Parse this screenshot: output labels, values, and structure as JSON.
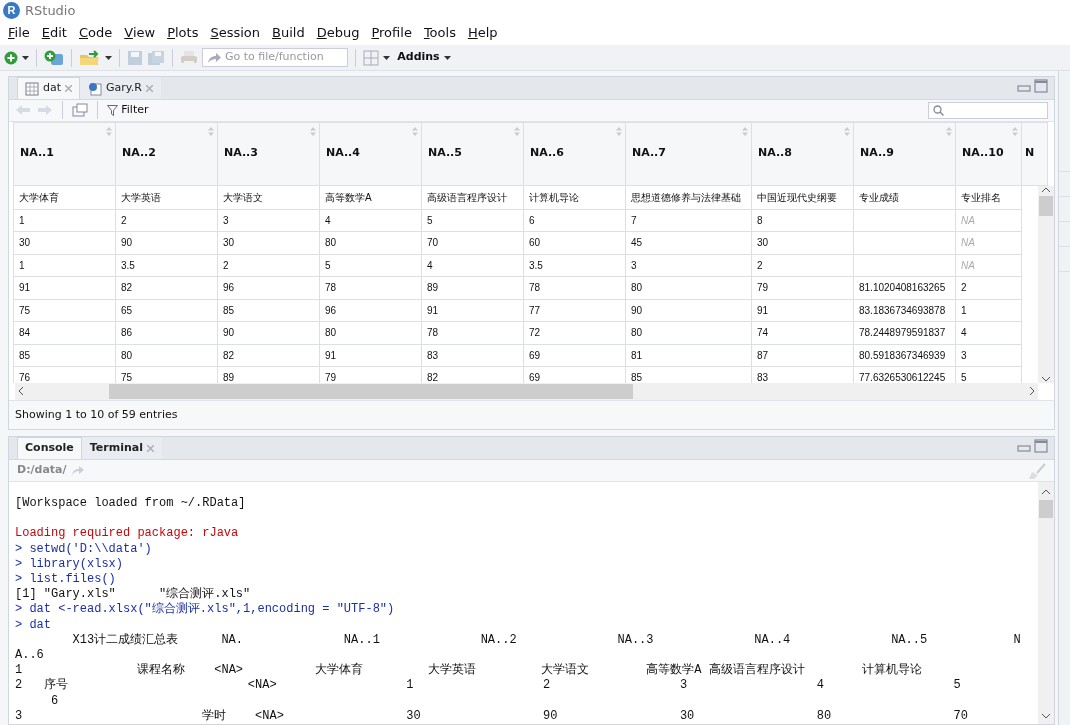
{
  "window": {
    "logo_text": "R",
    "title": "RStudio"
  },
  "menu": [
    "File",
    "Edit",
    "Code",
    "View",
    "Plots",
    "Session",
    "Build",
    "Debug",
    "Profile",
    "Tools",
    "Help"
  ],
  "toolbar": {
    "goto_placeholder": "Go to file/function",
    "addins": "Addins",
    "save_disabled": true,
    "print_disabled": true
  },
  "source_pane": {
    "tabs": [
      {
        "label": "dat",
        "kind": "data",
        "selected": true
      },
      {
        "label": "Gary.R",
        "kind": "script",
        "selected": false
      }
    ],
    "filter_label": "Filter",
    "history_disabled": true,
    "table": {
      "columns": [
        "NA..1",
        "NA..2",
        "NA..3",
        "NA..4",
        "NA..5",
        "NA..6",
        "NA..7",
        "NA..8",
        "NA..9",
        "NA..10",
        "N"
      ],
      "rows": [
        {
          "cells": [
            "大学体育",
            "大学英语",
            "大学语文",
            "高等数学A",
            "高级语言程序设计",
            "计算机导论",
            "思想道德修养与法律基础",
            "中国近现代史纲要",
            "专业成绩",
            "专业排名"
          ]
        },
        {
          "cells": [
            "1",
            "2",
            "3",
            "4",
            "5",
            "6",
            "7",
            "8",
            null,
            {
              "text": "NA",
              "missing": true
            }
          ]
        },
        {
          "cells": [
            "30",
            "90",
            "30",
            "80",
            "70",
            "60",
            "45",
            "30",
            null,
            {
              "text": "NA",
              "missing": true
            }
          ]
        },
        {
          "cells": [
            "1",
            "3.5",
            "2",
            "5",
            "4",
            "3.5",
            "3",
            "2",
            null,
            {
              "text": "NA",
              "missing": true
            }
          ]
        },
        {
          "cells": [
            "91",
            "82",
            "96",
            "78",
            "89",
            "78",
            "80",
            "79",
            "81.1020408163265",
            "2"
          ]
        },
        {
          "cells": [
            "75",
            "65",
            "85",
            "96",
            "91",
            "77",
            "90",
            "91",
            "83.1836734693878",
            "1"
          ]
        },
        {
          "cells": [
            "84",
            "86",
            "90",
            "80",
            "78",
            "72",
            "80",
            "74",
            "78.2448979591837",
            "4"
          ]
        },
        {
          "cells": [
            "85",
            "80",
            "82",
            "91",
            "83",
            "69",
            "81",
            "87",
            "80.5918367346939",
            "3"
          ]
        },
        {
          "cells": [
            "76",
            "75",
            "89",
            "79",
            "82",
            "69",
            "85",
            "83",
            "77.6326530612245",
            "5"
          ]
        }
      ]
    },
    "footer": "Showing 1 to 10 of 59 entries"
  },
  "console_pane": {
    "tabs": [
      {
        "label": "Console",
        "closable": false,
        "selected": true
      },
      {
        "label": "Terminal",
        "closable": true,
        "selected": false
      }
    ],
    "path": "D:/data/",
    "lines": [
      {
        "kind": "output",
        "text": "[Workspace loaded from ~/.RData]"
      },
      {
        "kind": "blank"
      },
      {
        "kind": "message",
        "text": "Loading required package: rJava"
      },
      {
        "kind": "input",
        "text": "> setwd('D:\\\\data')"
      },
      {
        "kind": "input",
        "text": "> library(xlsx)"
      },
      {
        "kind": "input",
        "text": "> list.files()"
      },
      {
        "kind": "output",
        "text": "[1] \"Gary.xls\"      \"综合测评.xls\""
      },
      {
        "kind": "input",
        "text": "> dat <-read.xlsx(\"综合测评.xls\",1,encoding = \"UTF-8\")"
      },
      {
        "kind": "input",
        "text": "> dat"
      },
      {
        "kind": "output",
        "text": "        X13计二成绩汇总表      NA.              NA..1              NA..2              NA..3              NA..4              NA..5            N"
      },
      {
        "kind": "output",
        "text": "A..6"
      },
      {
        "kind": "output",
        "text": "1                课程名称    <NA>          大学体育         大学英语         大学语文        高等数学A 高级语言程序设计        计算机导论"
      },
      {
        "kind": "output",
        "text": "2   序号                         <NA>                  1                  2                  3                  4                  5"
      },
      {
        "kind": "output",
        "text": "     6"
      },
      {
        "kind": "output",
        "text": "3                         学时    <NA>                 30                 90                 30                 80                 70"
      }
    ]
  }
}
